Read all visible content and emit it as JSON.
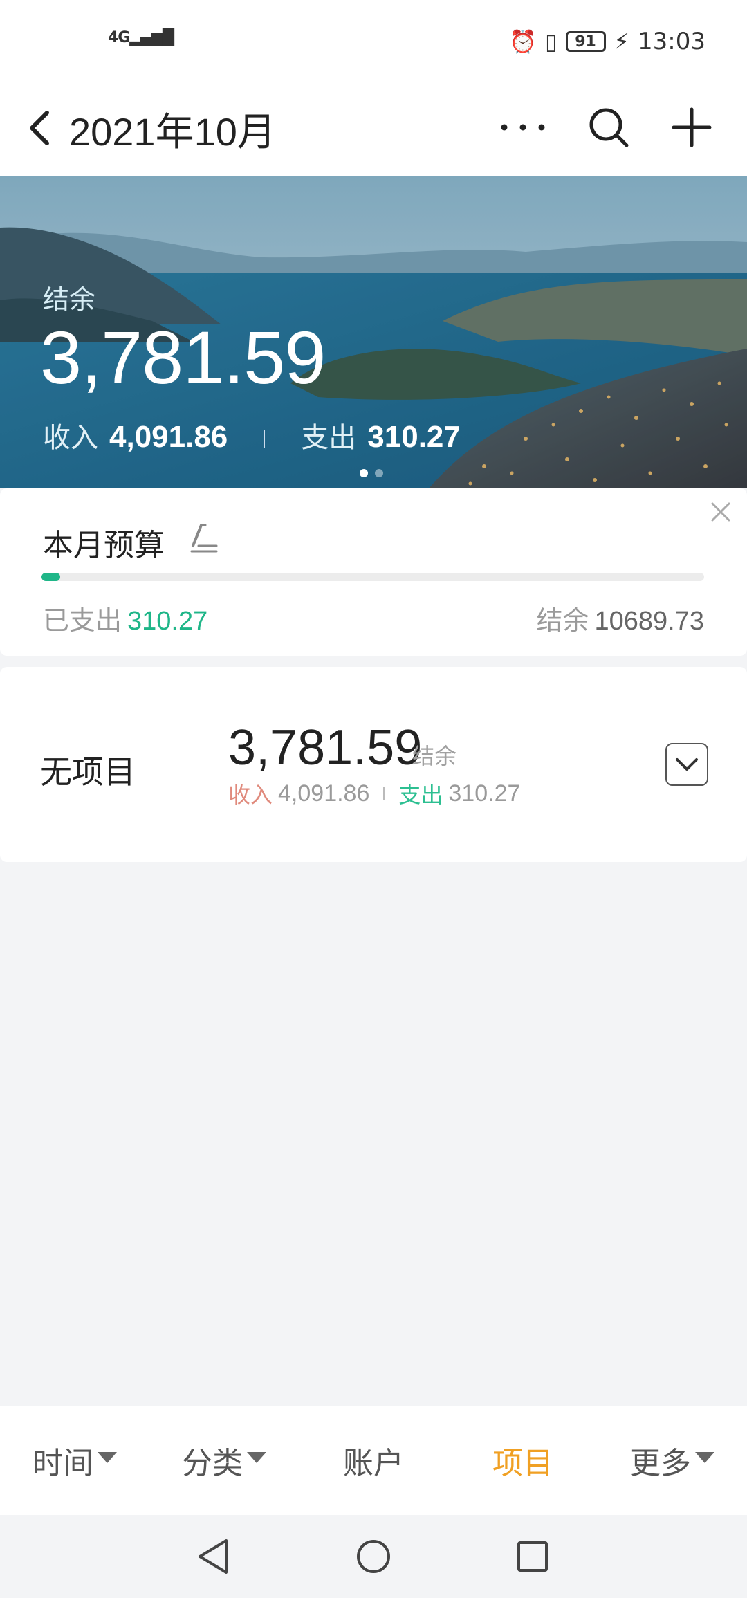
{
  "status_bar": {
    "signal": "4G",
    "battery": "91",
    "time": "13:03",
    "icons": [
      "signal-icon",
      "alarm-icon",
      "vibrate-icon",
      "battery-icon",
      "charging-icon"
    ]
  },
  "header": {
    "title": "2021年10月",
    "icons": {
      "back": "back-arrow-icon",
      "more": "more-icon",
      "search": "search-icon",
      "add": "plus-icon"
    }
  },
  "summary": {
    "balance_label": "结余",
    "balance_value": "3,781.59",
    "income_label": "收入",
    "income_value": "4,091.86",
    "expense_label": "支出",
    "expense_value": "310.27",
    "carousel_pages": 2,
    "carousel_active": 0
  },
  "budget": {
    "title": "本月预算",
    "spent_label": "已支出",
    "spent_value": "310.27",
    "balance_label": "结余",
    "balance_value": "10689.73",
    "progress_fraction": 0.028,
    "colors": {
      "accent": "#1fb688"
    }
  },
  "project": {
    "name": "无项目",
    "amount": "3,781.59",
    "amount_label": "结余",
    "income_label": "收入",
    "income_value": "4,091.86",
    "expense_label": "支出",
    "expense_value": "310.27",
    "colors": {
      "income": "#e08a7c",
      "expense": "#2cbf91"
    }
  },
  "tabs": [
    {
      "label": "时间",
      "has_dropdown": true,
      "active": false
    },
    {
      "label": "分类",
      "has_dropdown": true,
      "active": false
    },
    {
      "label": "账户",
      "has_dropdown": false,
      "active": false
    },
    {
      "label": "项目",
      "has_dropdown": false,
      "active": true
    },
    {
      "label": "更多",
      "has_dropdown": true,
      "active": false
    }
  ],
  "tab_active_color": "#f0a023",
  "nav": {
    "back": "nav-back-icon",
    "home": "nav-home-icon",
    "recents": "nav-recents-icon"
  }
}
